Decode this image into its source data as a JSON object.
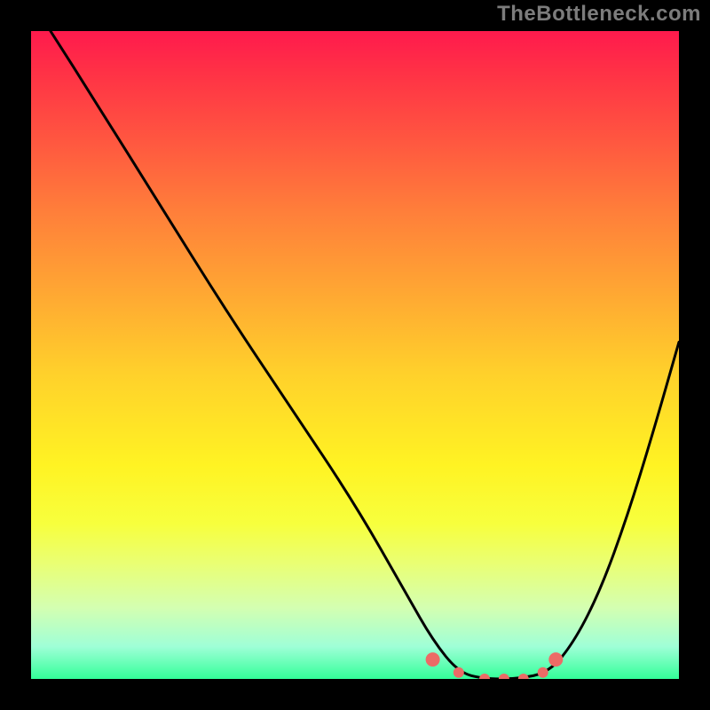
{
  "watermark": "TheBottleneck.com",
  "chart_data": {
    "type": "line",
    "title": "",
    "xlabel": "",
    "ylabel": "",
    "xlim": [
      0,
      100
    ],
    "ylim": [
      0,
      100
    ],
    "grid": false,
    "series": [
      {
        "name": "curve",
        "color": "#000000",
        "x": [
          3,
          10,
          20,
          30,
          40,
          50,
          58,
          62,
          66,
          70,
          75,
          80,
          84,
          88,
          92,
          96,
          100
        ],
        "values": [
          100,
          89,
          73,
          57,
          42,
          27,
          13,
          6,
          1,
          0,
          0,
          1,
          6,
          14,
          25,
          38,
          52
        ]
      },
      {
        "name": "markers",
        "type": "scatter",
        "color": "#ec6b66",
        "x": [
          62,
          66,
          70,
          73,
          76,
          79,
          81
        ],
        "values": [
          3,
          1,
          0,
          0,
          0,
          1,
          3
        ]
      }
    ],
    "background_gradient": {
      "top": "#ff1a4d",
      "mid": "#ffe824",
      "bottom": "#33ff99"
    }
  }
}
